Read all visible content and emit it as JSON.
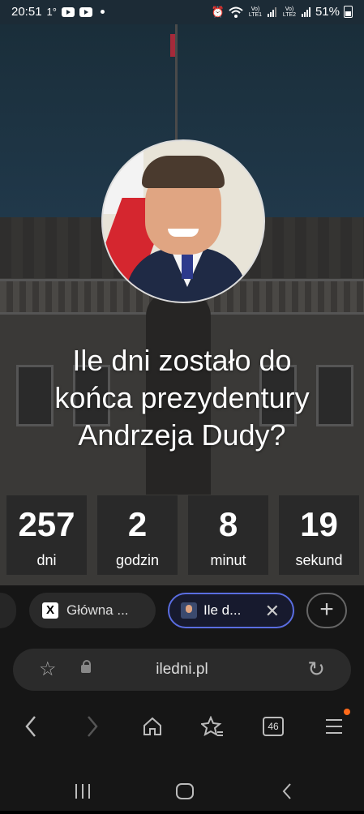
{
  "status_bar": {
    "time": "20:51",
    "temp": "1°",
    "sim1": "Vo) LTE1",
    "sim2": "Vo) LTE2",
    "battery": "51%"
  },
  "page": {
    "heading_line1": "Ile dni zostało do",
    "heading_line2": "końca prezydentury",
    "heading_line3": "Andrzeja Dudy?",
    "counters": [
      {
        "value": "257",
        "unit": "dni"
      },
      {
        "value": "2",
        "unit": "godzin"
      },
      {
        "value": "8",
        "unit": "minut"
      },
      {
        "value": "19",
        "unit": "sekund"
      }
    ]
  },
  "tabs": {
    "items": [
      {
        "label": "Główna ...",
        "active": false
      },
      {
        "label": "Ile d...",
        "active": true
      }
    ],
    "add_label": "+",
    "close_label": "✕"
  },
  "urlbar": {
    "url": "iledni.pl"
  },
  "toolbar": {
    "tab_count": "46"
  },
  "colors": {
    "active_tab_border": "#5a6de0",
    "notification_dot": "#ff6a1a"
  }
}
